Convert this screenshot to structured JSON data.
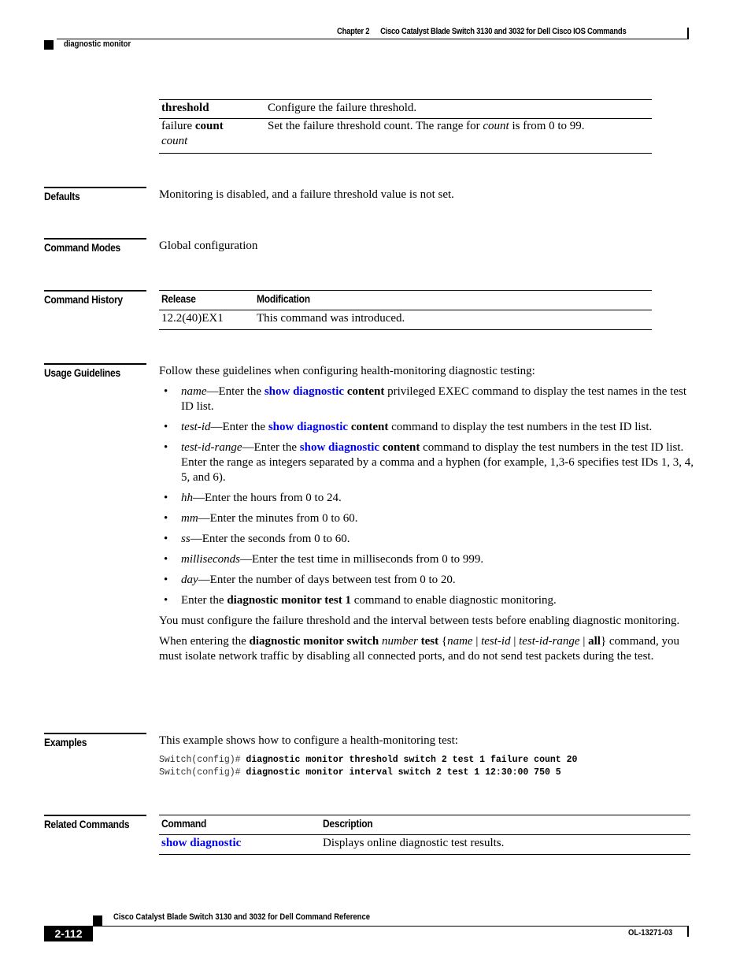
{
  "header": {
    "chapter": "Chapter 2",
    "book_title": "Cisco Catalyst Blade Switch 3130 and 3032 for Dell Cisco IOS Commands",
    "section": "diagnostic monitor"
  },
  "syntax_table": {
    "rows": [
      {
        "keyword_bold": "threshold",
        "keyword_plain": "",
        "keyword_italic": "",
        "description": "Configure the failure threshold."
      },
      {
        "keyword_plain": "failure ",
        "keyword_bold": "count",
        "keyword_italic": "count",
        "description_pre": "Set the failure threshold count. The range for ",
        "description_italic": "count",
        "description_post": " is from 0 to 99."
      }
    ]
  },
  "defaults": {
    "label": "Defaults",
    "text": "Monitoring is disabled, and a failure threshold value is not set."
  },
  "command_modes": {
    "label": "Command Modes",
    "text": "Global configuration"
  },
  "command_history": {
    "label": "Command History",
    "columns": [
      "Release",
      "Modification"
    ],
    "rows": [
      {
        "release": "12.2(40)EX1",
        "modification": "This command was introduced."
      }
    ]
  },
  "usage_guidelines": {
    "label": "Usage Guidelines",
    "intro": "Follow these guidelines when configuring health-monitoring diagnostic testing:",
    "bullets": {
      "b1": {
        "term": "name",
        "pre": "—Enter the ",
        "link": "show diagnostic",
        "bold": " content",
        "post": " privileged EXEC command to display the test names in the test ID list."
      },
      "b2": {
        "term": "test-id",
        "pre": "—Enter the ",
        "link": "show diagnostic",
        "bold": " content",
        "post": " command to display the test numbers in the test ID list."
      },
      "b3": {
        "term": "test-id-range",
        "pre": "—Enter the ",
        "link": "show diagnostic",
        "bold": " content",
        "post": " command to display the test numbers in the test ID list. Enter the range as integers separated by a comma and a hyphen (for example, 1,3-6 specifies test IDs 1, 3, 4, 5, and 6)."
      },
      "b4": {
        "term": "hh",
        "post": "—Enter the hours from 0 to 24."
      },
      "b5": {
        "term": "mm",
        "post": "—Enter the minutes from 0 to 60."
      },
      "b6": {
        "term": "ss",
        "post": "—Enter the seconds from 0 to 60."
      },
      "b7": {
        "term": "milliseconds",
        "post": "—Enter the test time in milliseconds from 0 to 999."
      },
      "b8": {
        "term": "day",
        "post": "—Enter the number of days between test from 0 to 20."
      },
      "b9": {
        "pre": "Enter the ",
        "bold": "diagnostic monitor test 1",
        "post": " command to enable diagnostic monitoring."
      }
    },
    "para1": "You must configure the failure threshold and the interval between tests before enabling diagnostic monitoring.",
    "para2": {
      "pre": "When entering the ",
      "cmd": "diagnostic monitor switch",
      "arg": " number",
      "test": " test",
      "brace_open": " {",
      "opt1": "name",
      "sep1": " | ",
      "opt2": "test-id",
      "sep2": " | ",
      "opt3": "test-id-range",
      "sep3": " | ",
      "opt4": "all",
      "brace_close": "}",
      "post": " command, you must isolate network traffic by disabling all connected ports, and do not send test packets during the test."
    }
  },
  "examples": {
    "label": "Examples",
    "intro": "This example shows how to configure a health-monitoring test:",
    "lines": [
      {
        "prompt": "Switch(config)# ",
        "command": "diagnostic monitor threshold switch 2 test 1 failure count 20"
      },
      {
        "prompt": "Switch(config)# ",
        "command": "diagnostic monitor interval switch 2 test 1 12:30:00 750 5"
      }
    ]
  },
  "related_commands": {
    "label": "Related Commands",
    "columns": [
      "Command",
      "Description"
    ],
    "rows": [
      {
        "command": "show diagnostic",
        "description": "Displays online diagnostic test results."
      }
    ]
  },
  "footer": {
    "title": "Cisco Catalyst Blade Switch 3130 and 3032 for Dell Command Reference",
    "page": "2-112",
    "doc_number": "OL-13271-03"
  },
  "colors": {
    "link": "#0000ee",
    "text": "#000000"
  }
}
